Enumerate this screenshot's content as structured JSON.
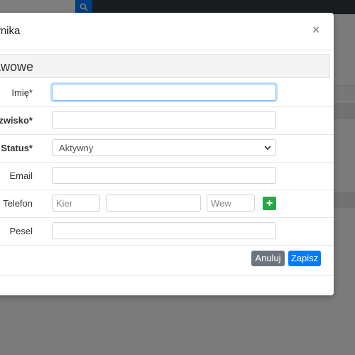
{
  "modal": {
    "title": "wnika",
    "close_label": "×",
    "section_title": "awowe"
  },
  "form": {
    "first_name": {
      "label": "Imię*",
      "value": "",
      "placeholder": ""
    },
    "last_name": {
      "label": "zwisko*",
      "value": "",
      "placeholder": ""
    },
    "status": {
      "label": "Status*",
      "selected": "Aktywny"
    },
    "email": {
      "label": "Email",
      "value": "",
      "placeholder": ""
    },
    "phone": {
      "label": "Telefon",
      "area_placeholder": "Kier",
      "number_placeholder": "",
      "ext_placeholder": "Wew",
      "add_label": "+"
    },
    "pesel": {
      "label": "Pesel",
      "value": "",
      "placeholder": ""
    }
  },
  "buttons": {
    "cancel_label": "Anuluj",
    "save_label": "Zapisz"
  },
  "colors": {
    "primary": "#007bff",
    "secondary": "#6c757d",
    "success": "#28a745",
    "topbar": "#343a40"
  },
  "icons": {
    "search": "search-icon",
    "close": "close-icon",
    "chevron": "chevron-down-icon",
    "add": "plus-icon"
  }
}
